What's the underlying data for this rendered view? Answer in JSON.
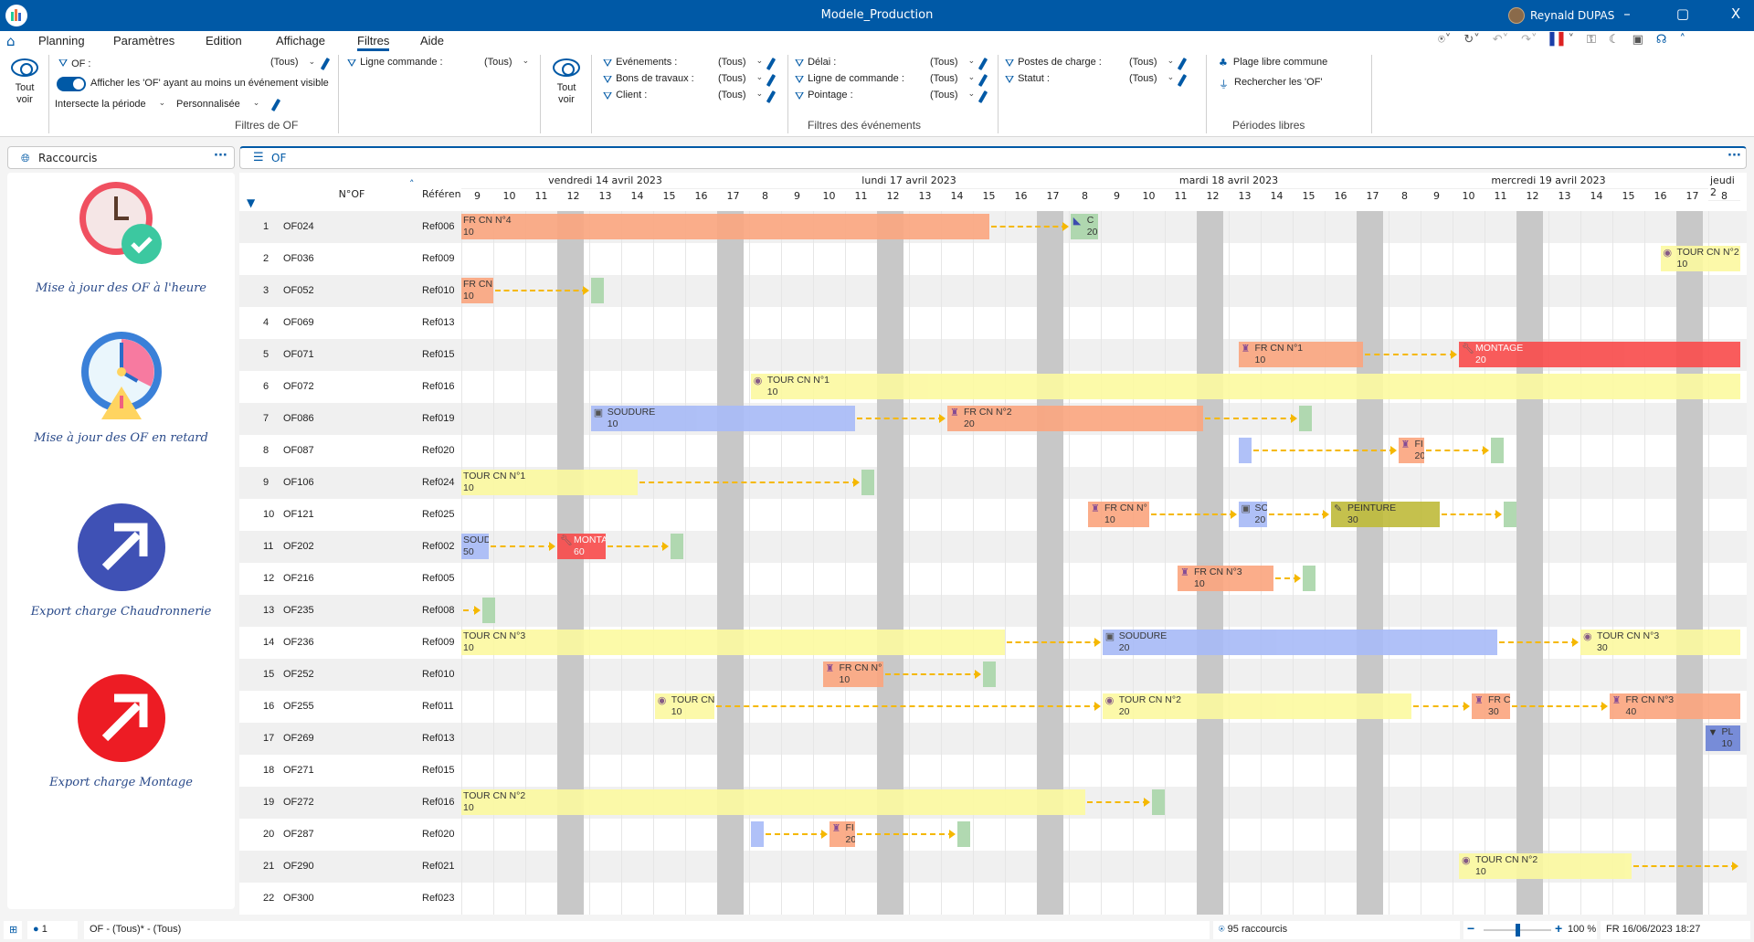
{
  "window": {
    "title": "Modele_Production",
    "user": "Reynald DUPAS",
    "minimize": "–",
    "restore": "▢",
    "close": "X"
  },
  "menu": {
    "items": [
      "Planning",
      "Paramètres",
      "Edition",
      "Affichage",
      "Filtres",
      "Aide"
    ],
    "active": "Filtres"
  },
  "ribbon": {
    "tout_voir_1": "Tout voir",
    "of_label": "OF :",
    "of_value": "(Tous)",
    "toggle_label": "Afficher les 'OF' ayant au moins un événement visible",
    "intersect": "Intersecte la période",
    "personnalisee": "Personnalisée",
    "ligne_commande": "Ligne commande :",
    "ligne_commande_value": "(Tous)",
    "group_of": "Filtres de OF",
    "tout_voir_2": "Tout voir",
    "evenements": "Evénements :",
    "bons": "Bons de travaux :",
    "client": "Client :",
    "delai": "Délai :",
    "ligne_de_commande": "Ligne de commande :",
    "pointage": "Pointage :",
    "postes": "Postes de charge :",
    "statut": "Statut :",
    "tous": "(Tous)",
    "group_evt": "Filtres des événements",
    "plage": "Plage libre commune",
    "rechercher": "Rechercher les 'OF'",
    "group_periodes": "Périodes libres"
  },
  "left_panel": {
    "title": "Raccourcis",
    "more": "···",
    "shortcuts": [
      {
        "label": "Mise à jour des OF à l'heure",
        "icon": "clock-check-icon"
      },
      {
        "label": "Mise à jour des OF en retard",
        "icon": "clock-warning-icon"
      },
      {
        "label": "Export charge Chaudronnerie",
        "icon": "export-blue-icon",
        "color": "#3f51b5"
      },
      {
        "label": "Export charge Montage",
        "icon": "export-red-icon",
        "color": "#ed1c24"
      }
    ]
  },
  "main_panel": {
    "title": "OF",
    "more": "···",
    "col_of": "N°OF",
    "col_ref": "Référenc"
  },
  "timeline": {
    "days": [
      {
        "label": "vendredi 14 avril 2023",
        "hours": [
          9,
          10,
          11,
          12,
          13,
          14,
          15,
          16,
          17
        ]
      },
      {
        "label": "lundi 17 avril 2023",
        "hours": [
          8,
          9,
          10,
          11,
          12,
          13,
          14,
          15,
          16,
          17
        ]
      },
      {
        "label": "mardi 18 avril 2023",
        "hours": [
          8,
          9,
          10,
          11,
          12,
          13,
          14,
          15,
          16,
          17
        ]
      },
      {
        "label": "mercredi 19 avril 2023",
        "hours": [
          8,
          9,
          10,
          11,
          12,
          13,
          14,
          15,
          16,
          17
        ]
      },
      {
        "label": "jeudi 2",
        "hours": [
          8
        ]
      }
    ],
    "blocked_hours": [
      12,
      17
    ]
  },
  "rows": [
    {
      "n": "1",
      "of": "OF024",
      "ref": "Ref006",
      "events": [
        {
          "type": "fr",
          "label": "FR CN N°4",
          "qty": "10",
          "start": 0,
          "end": 16.5
        },
        {
          "type": "arrow",
          "start": 16.5,
          "end": 19.05
        },
        {
          "type": "ctrl",
          "label": "C",
          "qty": "20",
          "start": 19.05,
          "end": 19.9,
          "icon": "set-square-icon"
        }
      ]
    },
    {
      "n": "2",
      "of": "OF036",
      "ref": "Ref009",
      "events": [
        {
          "type": "tour",
          "label": "TOUR CN N°2",
          "qty": "10",
          "start": 37.5,
          "end": 40,
          "icon": "lathe-icon"
        }
      ]
    },
    {
      "n": "3",
      "of": "OF052",
      "ref": "Ref010",
      "events": [
        {
          "type": "fr",
          "label": "FR CN",
          "qty": "10",
          "start": 0,
          "end": 1
        },
        {
          "type": "arrow",
          "start": 1,
          "end": 4.05
        },
        {
          "type": "ctrl",
          "label": "",
          "qty": "",
          "start": 4.05,
          "end": 4.45
        }
      ]
    },
    {
      "n": "4",
      "of": "OF069",
      "ref": "Ref013",
      "events": []
    },
    {
      "n": "5",
      "of": "OF071",
      "ref": "Ref015",
      "events": [
        {
          "type": "fr",
          "label": "FR CN N°1",
          "qty": "10",
          "start": 24.3,
          "end": 28.2,
          "icon": "mill-icon"
        },
        {
          "type": "arrow",
          "start": 28.2,
          "end": 31.2
        },
        {
          "type": "montage",
          "label": "MONTAGE",
          "qty": "20",
          "start": 31.2,
          "end": 40,
          "icon": "wrench-icon"
        }
      ]
    },
    {
      "n": "6",
      "of": "OF072",
      "ref": "Ref016",
      "events": [
        {
          "type": "tour",
          "label": "TOUR CN N°1",
          "qty": "10",
          "start": 9.05,
          "end": 40,
          "icon": "lathe-icon"
        }
      ]
    },
    {
      "n": "7",
      "of": "OF086",
      "ref": "Ref019",
      "events": [
        {
          "type": "soudure",
          "label": "SOUDURE",
          "qty": "10",
          "start": 4.05,
          "end": 12.3,
          "icon": "welding-mask-icon"
        },
        {
          "type": "arrow",
          "start": 12.3,
          "end": 15.2
        },
        {
          "type": "fr",
          "label": "FR CN N°2",
          "qty": "20",
          "start": 15.2,
          "end": 23.2,
          "icon": "mill-icon"
        },
        {
          "type": "arrow",
          "start": 23.2,
          "end": 26.2
        },
        {
          "type": "ctrl",
          "label": "",
          "qty": "",
          "start": 26.2,
          "end": 26.6
        }
      ]
    },
    {
      "n": "8",
      "of": "OF087",
      "ref": "Ref020",
      "events": [
        {
          "type": "soudure",
          "label": "",
          "qty": "",
          "start": 24.3,
          "end": 24.7
        },
        {
          "type": "arrow",
          "start": 24.7,
          "end": 29.3
        },
        {
          "type": "fr",
          "label": "FI",
          "qty": "20",
          "start": 29.3,
          "end": 30.1,
          "icon": "mill-icon"
        },
        {
          "type": "arrow",
          "start": 30.1,
          "end": 32.2
        },
        {
          "type": "ctrl",
          "label": "",
          "qty": "",
          "start": 32.2,
          "end": 32.6
        }
      ]
    },
    {
      "n": "9",
      "of": "OF106",
      "ref": "Ref024",
      "events": [
        {
          "type": "tour",
          "label": "TOUR CN N°1",
          "qty": "10",
          "start": 0,
          "end": 5.5
        },
        {
          "type": "arrow",
          "start": 5.5,
          "end": 12.5
        },
        {
          "type": "ctrl",
          "label": "",
          "qty": "",
          "start": 12.5,
          "end": 12.9
        }
      ]
    },
    {
      "n": "10",
      "of": "OF121",
      "ref": "Ref025",
      "events": [
        {
          "type": "fr",
          "label": "FR CN N°",
          "qty": "10",
          "start": 19.6,
          "end": 21.5,
          "icon": "mill-icon"
        },
        {
          "type": "arrow",
          "start": 21.5,
          "end": 24.3
        },
        {
          "type": "soudure",
          "label": "SO",
          "qty": "20",
          "start": 24.3,
          "end": 25.2,
          "icon": "welding-mask-icon"
        },
        {
          "type": "arrow",
          "start": 25.2,
          "end": 27.2
        },
        {
          "type": "peinture",
          "label": "PEINTURE",
          "qty": "30",
          "start": 27.2,
          "end": 30.6,
          "icon": "paint-brush-icon"
        },
        {
          "type": "arrow",
          "start": 30.6,
          "end": 32.6
        },
        {
          "type": "ctrl",
          "label": "",
          "qty": "",
          "start": 32.6,
          "end": 33.0
        }
      ]
    },
    {
      "n": "11",
      "of": "OF202",
      "ref": "Ref002",
      "events": [
        {
          "type": "soudure",
          "label": "SOUDI",
          "qty": "50",
          "start": 0,
          "end": 0.85
        },
        {
          "type": "arrow",
          "start": 0.85,
          "end": 3.0
        },
        {
          "type": "montage",
          "label": "MONTA",
          "qty": "60",
          "start": 3.0,
          "end": 4.5,
          "icon": "wrench-icon"
        },
        {
          "type": "arrow",
          "start": 4.5,
          "end": 6.55
        },
        {
          "type": "ctrl",
          "label": "",
          "qty": "",
          "start": 6.55,
          "end": 6.95
        }
      ]
    },
    {
      "n": "12",
      "of": "OF216",
      "ref": "Ref005",
      "events": [
        {
          "type": "fr",
          "label": "FR CN N°3",
          "qty": "10",
          "start": 22.4,
          "end": 25.4,
          "icon": "mill-icon"
        },
        {
          "type": "arrow",
          "start": 25.4,
          "end": 26.3
        },
        {
          "type": "ctrl",
          "label": "",
          "qty": "",
          "start": 26.3,
          "end": 26.7
        }
      ]
    },
    {
      "n": "13",
      "of": "OF235",
      "ref": "Ref008",
      "events": [
        {
          "type": "arrow",
          "start": 0,
          "end": 0.65
        },
        {
          "type": "ctrl",
          "label": "",
          "qty": "",
          "start": 0.65,
          "end": 1.05
        }
      ]
    },
    {
      "n": "14",
      "of": "OF236",
      "ref": "Ref009",
      "events": [
        {
          "type": "tour",
          "label": "TOUR CN N°3",
          "qty": "10",
          "start": 0,
          "end": 17.0
        },
        {
          "type": "arrow",
          "start": 17.0,
          "end": 20.05
        },
        {
          "type": "soudure",
          "label": "SOUDURE",
          "qty": "20",
          "start": 20.05,
          "end": 32.4,
          "icon": "welding-mask-icon"
        },
        {
          "type": "arrow",
          "start": 32.4,
          "end": 35.0
        },
        {
          "type": "tour",
          "label": "TOUR CN N°3",
          "qty": "30",
          "start": 35.0,
          "end": 40,
          "icon": "lathe-icon"
        }
      ]
    },
    {
      "n": "15",
      "of": "OF252",
      "ref": "Ref010",
      "events": [
        {
          "type": "fr",
          "label": "FR CN N°",
          "qty": "10",
          "start": 11.3,
          "end": 13.2,
          "icon": "mill-icon"
        },
        {
          "type": "arrow",
          "start": 13.2,
          "end": 16.3
        },
        {
          "type": "ctrl",
          "label": "",
          "qty": "",
          "start": 16.3,
          "end": 16.7
        }
      ]
    },
    {
      "n": "16",
      "of": "OF255",
      "ref": "Ref011",
      "events": [
        {
          "type": "tour",
          "label": "TOUR CN",
          "qty": "10",
          "start": 6.05,
          "end": 7.9,
          "icon": "lathe-icon"
        },
        {
          "type": "arrow",
          "start": 7.9,
          "end": 20.05
        },
        {
          "type": "tour",
          "label": "TOUR CN N°2",
          "qty": "20",
          "start": 20.05,
          "end": 29.7,
          "icon": "lathe-icon"
        },
        {
          "type": "arrow",
          "start": 29.7,
          "end": 31.6
        },
        {
          "type": "fr",
          "label": "FR C",
          "qty": "30",
          "start": 31.6,
          "end": 32.8,
          "icon": "mill-icon"
        },
        {
          "type": "arrow",
          "start": 32.8,
          "end": 35.9
        },
        {
          "type": "fr",
          "label": "FR CN N°3",
          "qty": "40",
          "start": 35.9,
          "end": 40,
          "icon": "mill-icon"
        }
      ]
    },
    {
      "n": "17",
      "of": "OF269",
      "ref": "Ref013",
      "events": [
        {
          "type": "plieuse",
          "label": "PL",
          "qty": "10",
          "start": 38.9,
          "end": 40,
          "icon": "press-icon"
        }
      ]
    },
    {
      "n": "18",
      "of": "OF271",
      "ref": "Ref015",
      "events": []
    },
    {
      "n": "19",
      "of": "OF272",
      "ref": "Ref016",
      "events": [
        {
          "type": "tour",
          "label": "TOUR CN N°2",
          "qty": "10",
          "start": 0,
          "end": 19.5
        },
        {
          "type": "arrow",
          "start": 19.5,
          "end": 21.6
        },
        {
          "type": "ctrl",
          "label": "",
          "qty": "",
          "start": 21.6,
          "end": 22.0
        }
      ]
    },
    {
      "n": "20",
      "of": "OF287",
      "ref": "Ref020",
      "events": [
        {
          "type": "soudure",
          "label": "",
          "qty": "",
          "start": 9.05,
          "end": 9.45
        },
        {
          "type": "arrow",
          "start": 9.45,
          "end": 11.5
        },
        {
          "type": "fr",
          "label": "FI",
          "qty": "20",
          "start": 11.5,
          "end": 12.3,
          "icon": "mill-icon"
        },
        {
          "type": "arrow",
          "start": 12.3,
          "end": 15.5
        },
        {
          "type": "ctrl",
          "label": "",
          "qty": "",
          "start": 15.5,
          "end": 15.9
        }
      ]
    },
    {
      "n": "21",
      "of": "OF290",
      "ref": "Ref021",
      "events": [
        {
          "type": "tour",
          "label": "TOUR CN N°2",
          "qty": "10",
          "start": 31.2,
          "end": 36.6,
          "icon": "lathe-icon"
        },
        {
          "type": "arrow",
          "start": 36.6,
          "end": 40
        }
      ]
    },
    {
      "n": "22",
      "of": "OF300",
      "ref": "Ref023",
      "events": []
    }
  ],
  "event_colors": {
    "fr": "#fba57e",
    "tour": "#fcf9a0",
    "soudure": "#a7baf7",
    "montage": "#f94b4b",
    "peinture": "#bfbb3a",
    "ctrl": "#a8d5a8",
    "plieuse": "#6b82d6"
  },
  "statusbar": {
    "users": "1",
    "filter": "OF - (Tous)* - (Tous)",
    "shortcuts": "95 raccourcis",
    "zoom": "100 %",
    "zoom_level_percent": 100,
    "datetime": "FR 16/06/2023 18:27"
  }
}
